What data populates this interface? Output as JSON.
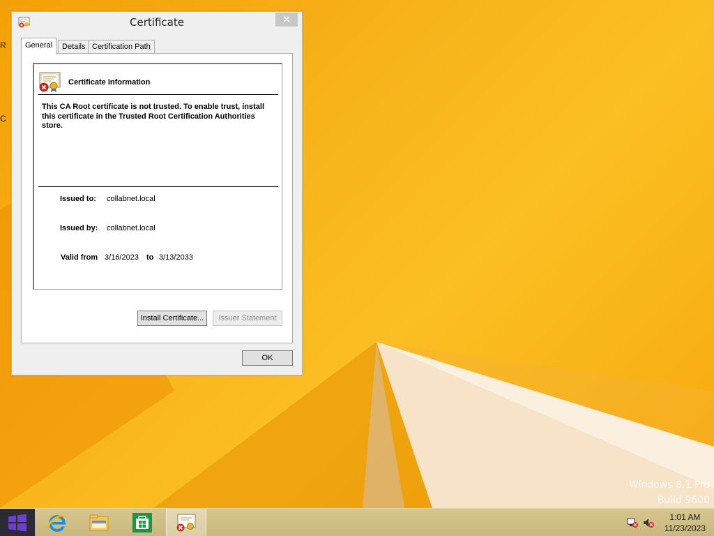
{
  "desktop": {
    "edge_letters": [
      "R",
      "C"
    ],
    "watermark": {
      "line1": "Windows 8.1 Pro",
      "line2": "Build 9600"
    }
  },
  "window": {
    "title": "Certificate",
    "close_glyph": "✕",
    "tabs": [
      {
        "label": "General",
        "active": true
      },
      {
        "label": "Details",
        "active": false
      },
      {
        "label": "Certification Path",
        "active": false
      }
    ],
    "info": {
      "heading": "Certificate Information",
      "warning": "This CA Root certificate is not trusted. To enable trust, install this certificate in the Trusted Root Certification Authorities store.",
      "issued_to_label": "Issued to:",
      "issued_to": "collabnet.local",
      "issued_by_label": "Issued by:",
      "issued_by": "collabnet.local",
      "valid_from_label": "Valid from",
      "valid_from": "3/16/2023",
      "to_label": "to",
      "valid_to": "3/13/2033"
    },
    "buttons": {
      "install": "Install Certificate...",
      "issuer_statement": "Issuer Statement",
      "ok": "OK"
    }
  },
  "taskbar": {
    "items": [
      {
        "icon": "windows-start-icon"
      },
      {
        "icon": "internet-explorer-icon"
      },
      {
        "icon": "file-explorer-icon"
      },
      {
        "icon": "windows-store-icon"
      },
      {
        "icon": "certificate-icon",
        "active": true
      }
    ],
    "tray": {
      "time": "1:01 AM",
      "date": "11/23/2023"
    }
  },
  "colors": {
    "desktop_orange": "#f6a800",
    "taskbar": "#cdbd83",
    "start_purple": "#6b3fd6",
    "ie_blue": "#1e8fe0",
    "store_green": "#139a43"
  }
}
